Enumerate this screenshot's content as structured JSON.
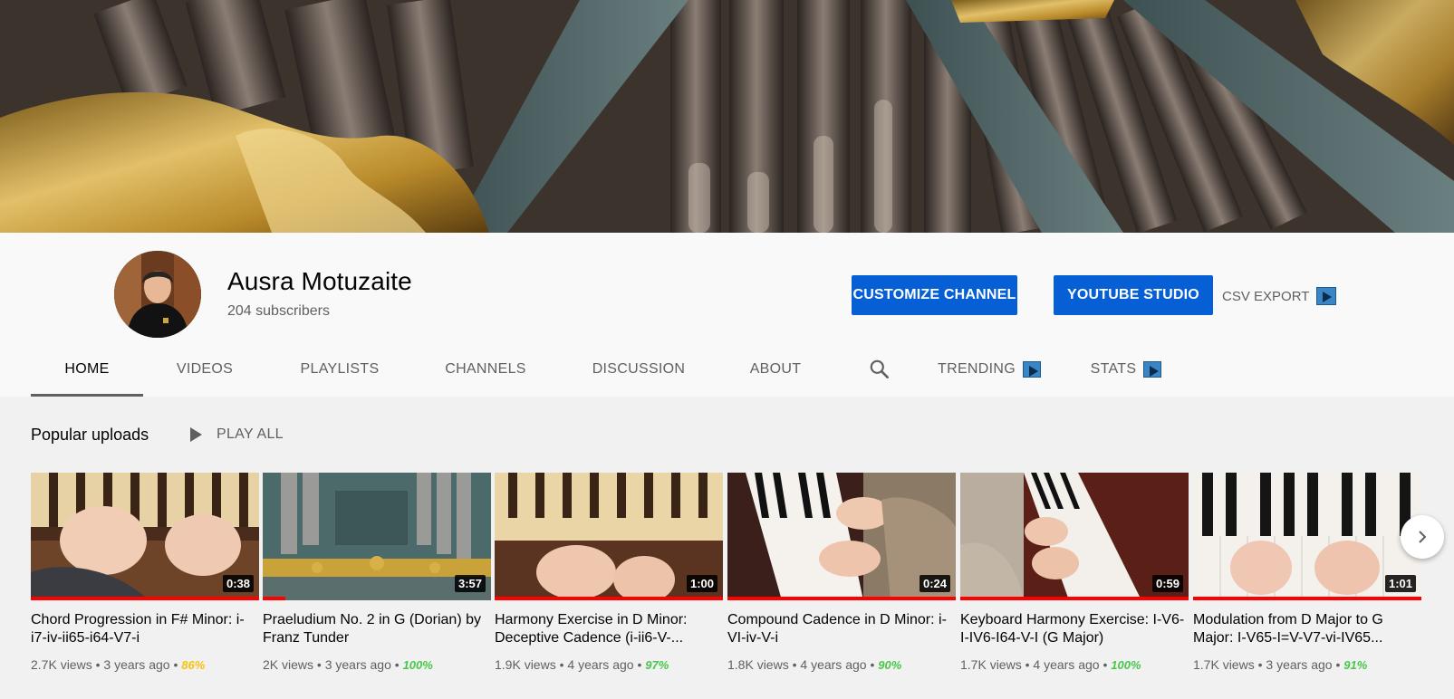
{
  "channel": {
    "name": "Ausra Motuzaite",
    "subscribers": "204 subscribers"
  },
  "actions": {
    "customize": "CUSTOMIZE CHANNEL",
    "studio": "YOUTUBE STUDIO",
    "csv_export": "CSV EXPORT"
  },
  "tabs": [
    {
      "label": "HOME",
      "active": true
    },
    {
      "label": "VIDEOS"
    },
    {
      "label": "PLAYLISTS"
    },
    {
      "label": "CHANNELS"
    },
    {
      "label": "DISCUSSION"
    },
    {
      "label": "ABOUT"
    },
    {
      "label": "TRENDING"
    },
    {
      "label": "STATS"
    }
  ],
  "shelf": {
    "title": "Popular uploads",
    "play_all": "PLAY ALL"
  },
  "videos": [
    {
      "title": "Chord Progression in F# Minor: i-i7-iv-ii65-i64-V7-i",
      "duration": "0:38",
      "views": "2.7K views",
      "age": "3 years ago",
      "rating": "86%",
      "rating_color": "#f9c20f",
      "watched": 1.0
    },
    {
      "title": "Praeludium No. 2 in G (Dorian) by Franz Tunder",
      "duration": "3:57",
      "views": "2K views",
      "age": "3 years ago",
      "rating": "100%",
      "rating_color": "#49c74a",
      "watched": 0.1
    },
    {
      "title": "Harmony Exercise in D Minor: Deceptive Cadence (i-ii6-V-...",
      "duration": "1:00",
      "views": "1.9K views",
      "age": "4 years ago",
      "rating": "97%",
      "rating_color": "#49c74a",
      "watched": 1.0
    },
    {
      "title": "Compound Cadence in D Minor: i-VI-iv-V-i",
      "duration": "0:24",
      "views": "1.8K views",
      "age": "4 years ago",
      "rating": "90%",
      "rating_color": "#49c74a",
      "watched": 1.0
    },
    {
      "title": "Keyboard Harmony Exercise: I-V6-I-IV6-I64-V-I (G Major)",
      "duration": "0:59",
      "views": "1.7K views",
      "age": "4 years ago",
      "rating": "100%",
      "rating_color": "#49c74a",
      "watched": 1.0
    },
    {
      "title": "Modulation from D Major to G Major: I-V65-I=V-V7-vi-IV65...",
      "duration": "1:01",
      "views": "1.7K views",
      "age": "3 years ago",
      "rating": "91%",
      "rating_color": "#49c74a",
      "watched": 1.0
    }
  ],
  "meta_separator": "•",
  "icons": {
    "search": "search-icon",
    "play": "play-icon",
    "next": "chevron-right-icon",
    "extension": "extension-badge-icon"
  }
}
